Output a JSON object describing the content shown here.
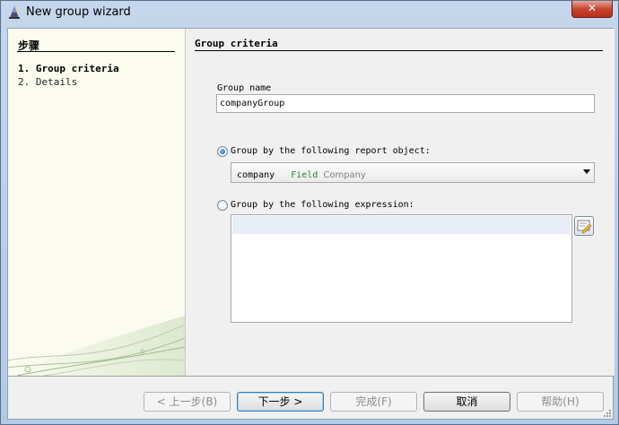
{
  "window": {
    "title": "New group wizard"
  },
  "steps": {
    "title": "步骤",
    "items": [
      {
        "number": "1.",
        "label": "Group criteria"
      },
      {
        "number": "2.",
        "label": "Details"
      }
    ]
  },
  "content": {
    "title": "Group criteria",
    "group_name_label": "Group name",
    "group_name_value": "companyGroup",
    "option_report_object": {
      "label": "Group by the following report object:",
      "checked": true
    },
    "report_object_select": {
      "name": "company",
      "kind": "Field",
      "field": "Company"
    },
    "option_expression": {
      "label": "Group by the following expression:",
      "checked": false
    },
    "expression_value": ""
  },
  "buttons": {
    "back": "< 上一步(B)",
    "next": "下一步 >",
    "finish": "完成(F)",
    "cancel": "取消",
    "help": "帮助(H)"
  },
  "colors": {
    "field_kind": "#2a8a2a",
    "title_bar": "#b3cae4",
    "close_button": "#c6452f"
  },
  "icons": {
    "app": "wizard-hat-icon",
    "close": "close-icon",
    "expression_builder": "expression-builder-icon",
    "dropdown": "chevron-down-icon"
  }
}
